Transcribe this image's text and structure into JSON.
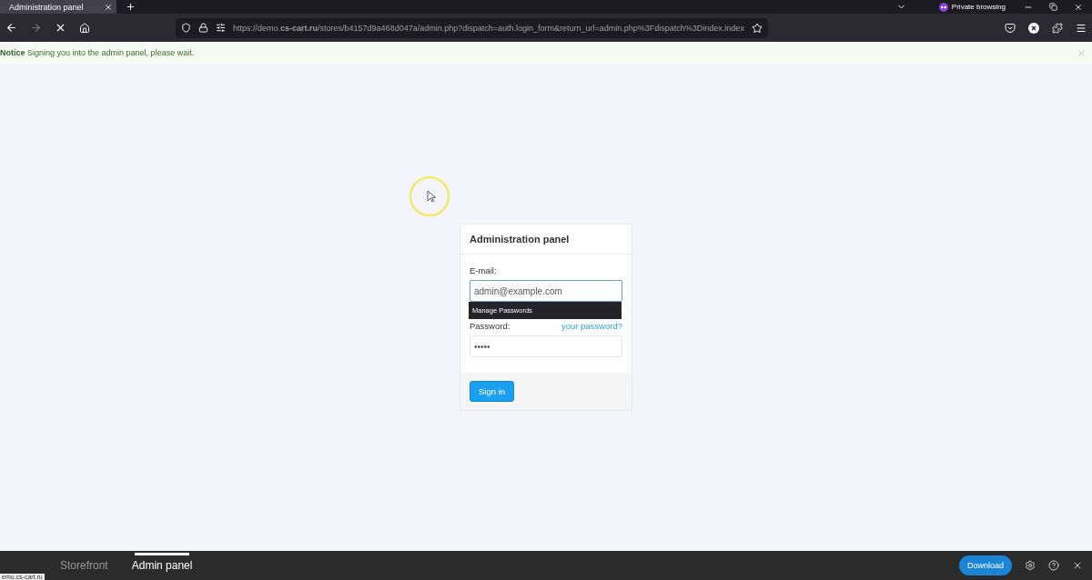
{
  "browser": {
    "tabs": [
      {
        "title": "Administration panel",
        "selected": true
      }
    ],
    "private_label": "Private browsing",
    "url": "https://demo.**cs-cart.ru**/stores/b4157d9a468d047a/admin.php?dispatch=auth.login_form&return_url=admin.php%3Fdispatch%3Dindex.index"
  },
  "notice": {
    "title": "Notice",
    "text": "Signing you into the admin panel, please wait."
  },
  "login": {
    "title": "Administration panel",
    "email_label": "E-mail:",
    "email_value": "admin@example.com",
    "password_label": "Password:",
    "forgot_link": "your password?",
    "password_value": "•••••",
    "submit": "Sign in"
  },
  "tooltip": "Manage Passwords",
  "demo_bar": {
    "tabs": [
      {
        "label": "Storefront",
        "selected": false
      },
      {
        "label": "Admin panel",
        "selected": true
      }
    ],
    "download": "Download"
  },
  "status_url": "emo.cs-cart.ru"
}
